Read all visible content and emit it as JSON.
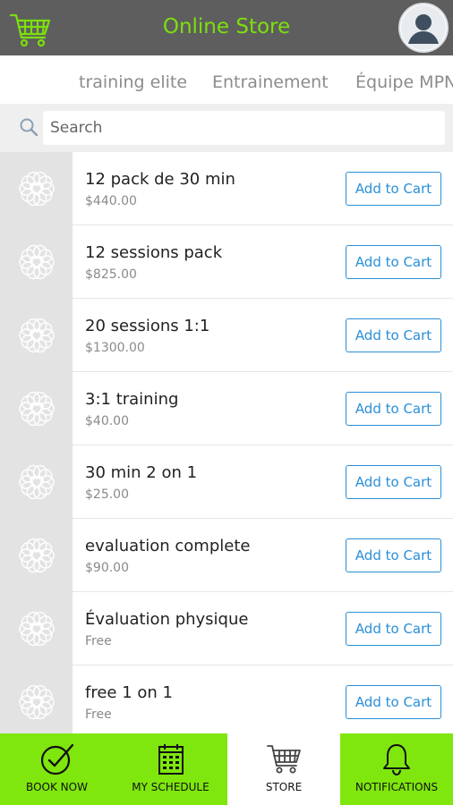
{
  "header": {
    "title": "Online Store",
    "logo_icon": "shopping-cart-icon",
    "avatar_icon": "user-avatar-icon"
  },
  "tabs": [
    "training elite",
    "Entrainement",
    "Équipe MPN"
  ],
  "search": {
    "placeholder": "Search"
  },
  "items": [
    {
      "name": "12 pack de 30 min",
      "price": "$440.00",
      "button": "Add to Cart"
    },
    {
      "name": "12 sessions pack",
      "price": "$825.00",
      "button": "Add to Cart"
    },
    {
      "name": "20 sessions 1:1",
      "price": "$1300.00",
      "button": "Add to Cart"
    },
    {
      "name": "3:1 training",
      "price": "$40.00",
      "button": "Add to Cart"
    },
    {
      "name": "30 min 2 on 1",
      "price": "$25.00",
      "button": "Add to Cart"
    },
    {
      "name": "evaluation complete",
      "price": "$90.00",
      "button": "Add to Cart"
    },
    {
      "name": "Évaluation physique",
      "price": "Free",
      "button": "Add to Cart"
    },
    {
      "name": "free 1 on 1",
      "price": "Free",
      "button": "Add to Cart"
    }
  ],
  "bottom_nav": [
    {
      "label": "BOOK NOW",
      "icon": "check-circle-icon",
      "active": false
    },
    {
      "label": "MY SCHEDULE",
      "icon": "calendar-icon",
      "active": false
    },
    {
      "label": "STORE",
      "icon": "shopping-cart-icon",
      "active": true
    },
    {
      "label": "NOTIFICATIONS",
      "icon": "bell-icon",
      "active": false
    }
  ],
  "colors": {
    "header_bg": "#5e5e5e",
    "accent_green": "#7ce00c",
    "button_blue": "#2a8fd8",
    "thumb_bg": "#e3e3e3"
  }
}
